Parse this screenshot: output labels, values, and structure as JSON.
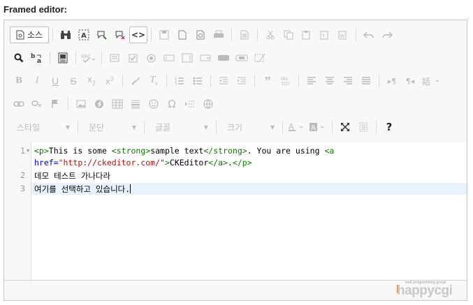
{
  "page": {
    "title": "Framed editor:"
  },
  "toolbar": {
    "source_label": "소스",
    "source_mode_label": "<>",
    "combos": {
      "style": "스타일",
      "format": "문단",
      "font": "글꼴",
      "size": "크기"
    },
    "help_label": "?",
    "icons": [
      "find-icon",
      "select-all-icon",
      "comment-icon",
      "uncomment-icon",
      "source-mode-icon",
      "save-icon",
      "new-page-icon",
      "preview-icon",
      "print-icon",
      "templates-icon",
      "cut-icon",
      "copy-icon",
      "paste-icon",
      "paste-text-icon",
      "paste-word-icon",
      "undo-icon",
      "redo-icon"
    ]
  },
  "editor": {
    "line_numbers": [
      "1",
      "2",
      "3"
    ],
    "fold_marker": "▼",
    "code": {
      "line1a_tag_p_open": "<p>",
      "line1a_text1": "This is some ",
      "line1a_tag_strong_open": "<strong>",
      "line1a_text2": "sample text",
      "line1a_tag_strong_close": "</strong>",
      "line1a_text3": ". You are using ",
      "line1a_tag_a": "<a",
      "line1b_attr": "href=",
      "line1b_str": "\"http://ckeditor.com/\"",
      "line1b_tag_gt": ">",
      "line1b_text": "CKEditor",
      "line1b_tag_a_close": "</a>",
      "line1b_text2": ".",
      "line1b_tag_p_close": "</p>",
      "line2": "데모 테스트 가나다라",
      "line3": "여기를 선택하고 있습니다."
    }
  },
  "watermark": {
    "small": "web programming group",
    "big": "happycgi"
  },
  "colors": {
    "tag": "#117700",
    "attr": "#0000cc",
    "string": "#aa1111",
    "active_line": "#e8f2ff",
    "watermark_accent": "#e08a3c"
  }
}
